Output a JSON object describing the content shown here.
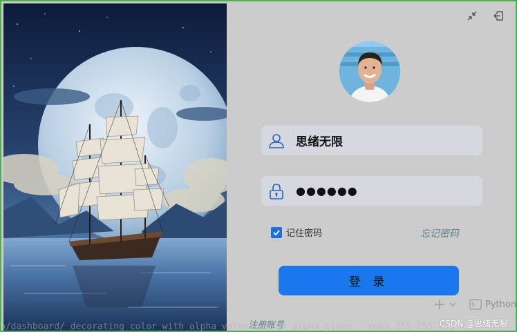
{
  "window": {
    "border_color": "#4caf50",
    "background": "#cccccc"
  },
  "titlebar": {
    "minimize_icon": "shrink-arrows-icon",
    "exit_icon": "logout-icon"
  },
  "login": {
    "username_icon": "user-icon",
    "username_value": "思绪无限",
    "password_icon": "lock-icon",
    "password_value": "●●●●●●",
    "remember_label": "记住密码",
    "remember_checked": true,
    "forgot_label": "忘记密码",
    "login_button_label": "登 录",
    "register_label": "注册账号",
    "accent_color": "#1a78ef"
  },
  "ide_overlay": {
    "add_icon": "plus-icon",
    "dropdown_icon": "chevron-down-icon",
    "terminal_icon": "terminal-icon",
    "terminal_label": "Python",
    "console_text": "b/dashboard/ decorating color with alpha value but no alpha given: 'rgba 255 255 255"
  },
  "watermark": "CSDN @思绪无限"
}
